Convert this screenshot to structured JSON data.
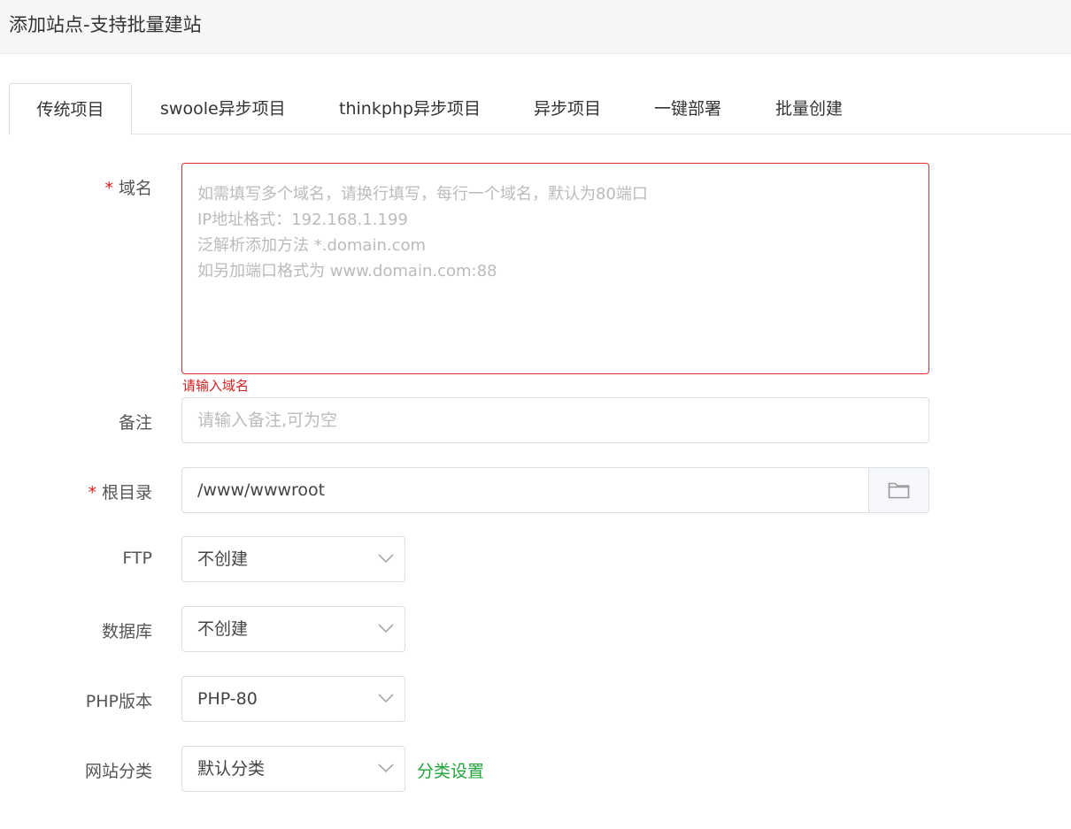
{
  "header": {
    "title": "添加站点-支持批量建站"
  },
  "tabs": [
    {
      "label": "传统项目",
      "active": true
    },
    {
      "label": "swoole异步项目"
    },
    {
      "label": "thinkphp异步项目"
    },
    {
      "label": "异步项目"
    },
    {
      "label": "一键部署"
    },
    {
      "label": "批量创建"
    }
  ],
  "form": {
    "domain": {
      "required_mark": "*",
      "label": "域名",
      "placeholder_lines": [
        "如需填写多个域名，请换行填写，每行一个域名，默认为80端口",
        "IP地址格式：192.168.1.199",
        "泛解析添加方法 *.domain.com",
        "如另加端口格式为 www.domain.com:88"
      ],
      "error": "请输入域名"
    },
    "remark": {
      "label": "备注",
      "placeholder": "请输入备注,可为空"
    },
    "root": {
      "required_mark": "*",
      "label": "根目录",
      "value": "/www/wwwroot",
      "button_icon": "folder-icon"
    },
    "ftp": {
      "label": "FTP",
      "value": "不创建"
    },
    "database": {
      "label": "数据库",
      "value": "不创建"
    },
    "php": {
      "label": "PHP版本",
      "value": "PHP-80"
    },
    "category": {
      "label": "网站分类",
      "value": "默认分类",
      "link": "分类设置"
    }
  },
  "colors": {
    "accent_green": "#20a53a",
    "error_red": "#e02020"
  }
}
